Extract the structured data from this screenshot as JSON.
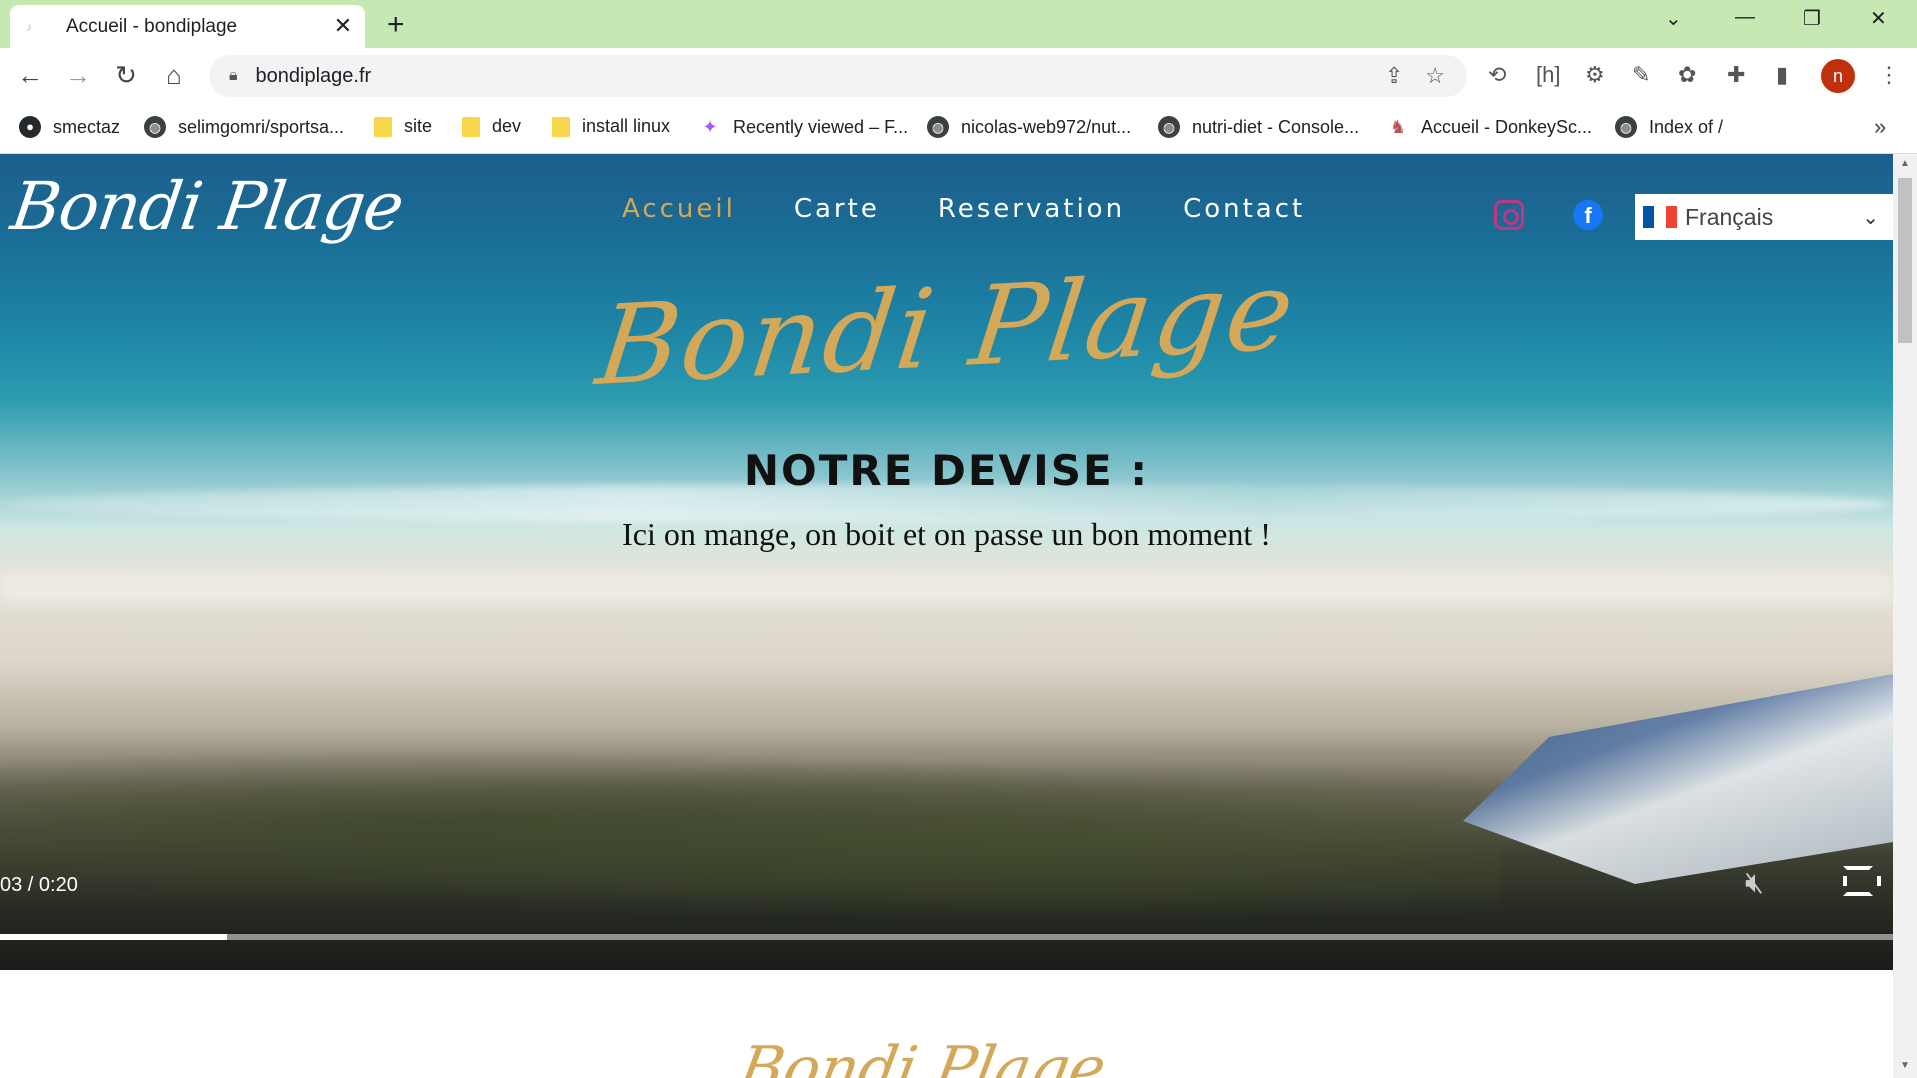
{
  "browser": {
    "tab_title": "Accueil - bondiplage",
    "url": "bondiplage.fr",
    "profile_initial": "n",
    "bookmarks": [
      {
        "label": "smectaz",
        "icon": "github-icon"
      },
      {
        "label": "selimgomri/sportsa...",
        "icon": "globe-icon"
      },
      {
        "label": "site",
        "icon": "folder-icon"
      },
      {
        "label": "dev",
        "icon": "folder-icon"
      },
      {
        "label": "install linux",
        "icon": "folder-icon"
      },
      {
        "label": "Recently viewed – F...",
        "icon": "figma-icon"
      },
      {
        "label": "nicolas-web972/nut...",
        "icon": "globe-icon"
      },
      {
        "label": "nutri-diet - Console...",
        "icon": "globe-icon"
      },
      {
        "label": "Accueil - DonkeySc...",
        "icon": "donkey-icon"
      },
      {
        "label": "Index of /",
        "icon": "globe-icon"
      }
    ]
  },
  "site": {
    "logo": "Bondi Plage",
    "nav": [
      "Accueil",
      "Carte",
      "Reservation",
      "Contact"
    ],
    "active_nav": "Accueil",
    "language": "Français",
    "hero_title": "Bondi Plage",
    "motto_title": "NOTRE DEVISE :",
    "motto_text": "Ici on mange, on boit et on passe un bon moment !",
    "video_time": "03 / 0:20",
    "video_progress_fraction": 0.12,
    "below_title": "Bondi Plage"
  },
  "colors": {
    "accent_gold": "#d3a858",
    "instagram": "#c13584",
    "facebook": "#1877f2",
    "browser_frame": "#c6e9b4"
  }
}
